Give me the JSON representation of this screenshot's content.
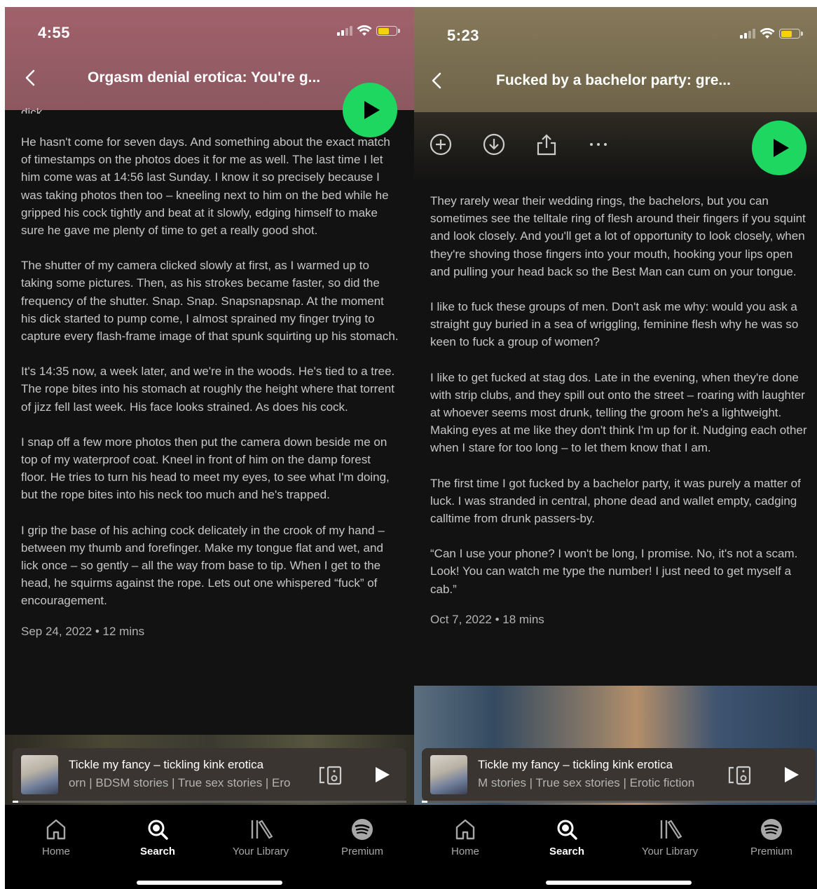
{
  "left": {
    "status": {
      "time": "4:55"
    },
    "header": {
      "title": "Orgasm denial erotica: You're g..."
    },
    "body": {
      "cut_text": "dick.",
      "paragraphs": [
        "He hasn't come for seven days. And something about the exact match of timestamps on the photos does it for me as well. The last time I let him come was at 14:56 last Sunday. I know it so precisely because I was taking photos then too – kneeling next to him on the bed while he gripped his cock tightly and beat at it slowly, edging himself to make sure he gave me plenty of time to get a really good shot.",
        "The shutter of my camera clicked slowly at first, as I warmed up to taking some pictures. Then, as his strokes became faster, so did the frequency of the shutter. Snap. Snap. Snapsnapsnap. At the moment his dick started to pump come, I almost sprained my finger trying to capture every flash-frame image of that spunk squirting up his stomach.",
        "It's 14:35 now, a week later, and we're in the woods. He's tied to a tree. The rope bites into his stomach at roughly the height where that torrent of jizz fell last week. His face looks strained. As does his cock.",
        "I snap off a few more photos then put the camera down beside me on top of my waterproof coat. Kneel in front of him on the damp forest floor. He tries to turn his head to meet my eyes, to see what I'm doing, but the rope bites into his neck too much and he's trapped.",
        "I grip the base of his aching cock delicately in the crook of my hand – between my thumb and forefinger. Make my tongue flat and wet, and lick once – so gently – all the way from base to tip. When I get to the head, he squirms against the rope. Lets out one whispered “fuck” of encouragement."
      ],
      "meta": "Sep 24, 2022 • 12 mins"
    },
    "mini_player": {
      "title": "Tickle my fancy – tickling kink erotica",
      "subtitle": "orn | BDSM stories | True sex stories | Ero"
    }
  },
  "right": {
    "status": {
      "time": "5:23"
    },
    "header": {
      "title": "Fucked by a bachelor party: gre..."
    },
    "body": {
      "paragraphs": [
        "They rarely wear their wedding rings, the bachelors, but you can sometimes see the telltale ring of flesh around their fingers if you squint and look closely. And you'll get a lot of opportunity to look closely, when they're shoving those fingers into your mouth, hooking your lips open and pulling your head back so the Best Man can cum on your tongue.",
        "I like to fuck these groups of men. Don't ask me why: would you ask a straight guy buried in a sea of wriggling, feminine flesh why he was so keen to fuck a group of women?",
        "I like to get fucked at stag dos. Late in the evening, when they're done with strip clubs, and they spill out onto the street – roaring with laughter at whoever seems most drunk, telling the groom he's a lightweight. Making eyes at me like they don't think I'm up for it. Nudging each other when I stare for too long – to let them know that I am.",
        "The first time I got fucked by a bachelor party, it was purely a matter of luck. I was stranded in central, phone dead and wallet empty, cadging calltime from drunk passers-by.",
        "“Can I use your phone? I won't be long, I promise. No, it's not a scam. Look! You can watch me type the number! I just need to get myself a cab.”"
      ],
      "meta": "Oct 7, 2022 • 18 mins"
    },
    "mini_player": {
      "title": "Tickle my fancy – tickling kink erotica",
      "subtitle": "M stories | True sex stories | Erotic fiction"
    }
  },
  "nav": {
    "home": "Home",
    "search": "Search",
    "library": "Your Library",
    "premium": "Premium"
  },
  "colors": {
    "accent": "#1ed760",
    "background": "#121212",
    "left_header": "#a1616b",
    "right_header": "#86795a"
  },
  "icons": [
    "back-chevron-icon",
    "play-icon",
    "add-circle-icon",
    "download-icon",
    "share-icon",
    "more-icon",
    "device-icon",
    "home-icon",
    "search-icon",
    "library-icon",
    "spotify-icon"
  ]
}
